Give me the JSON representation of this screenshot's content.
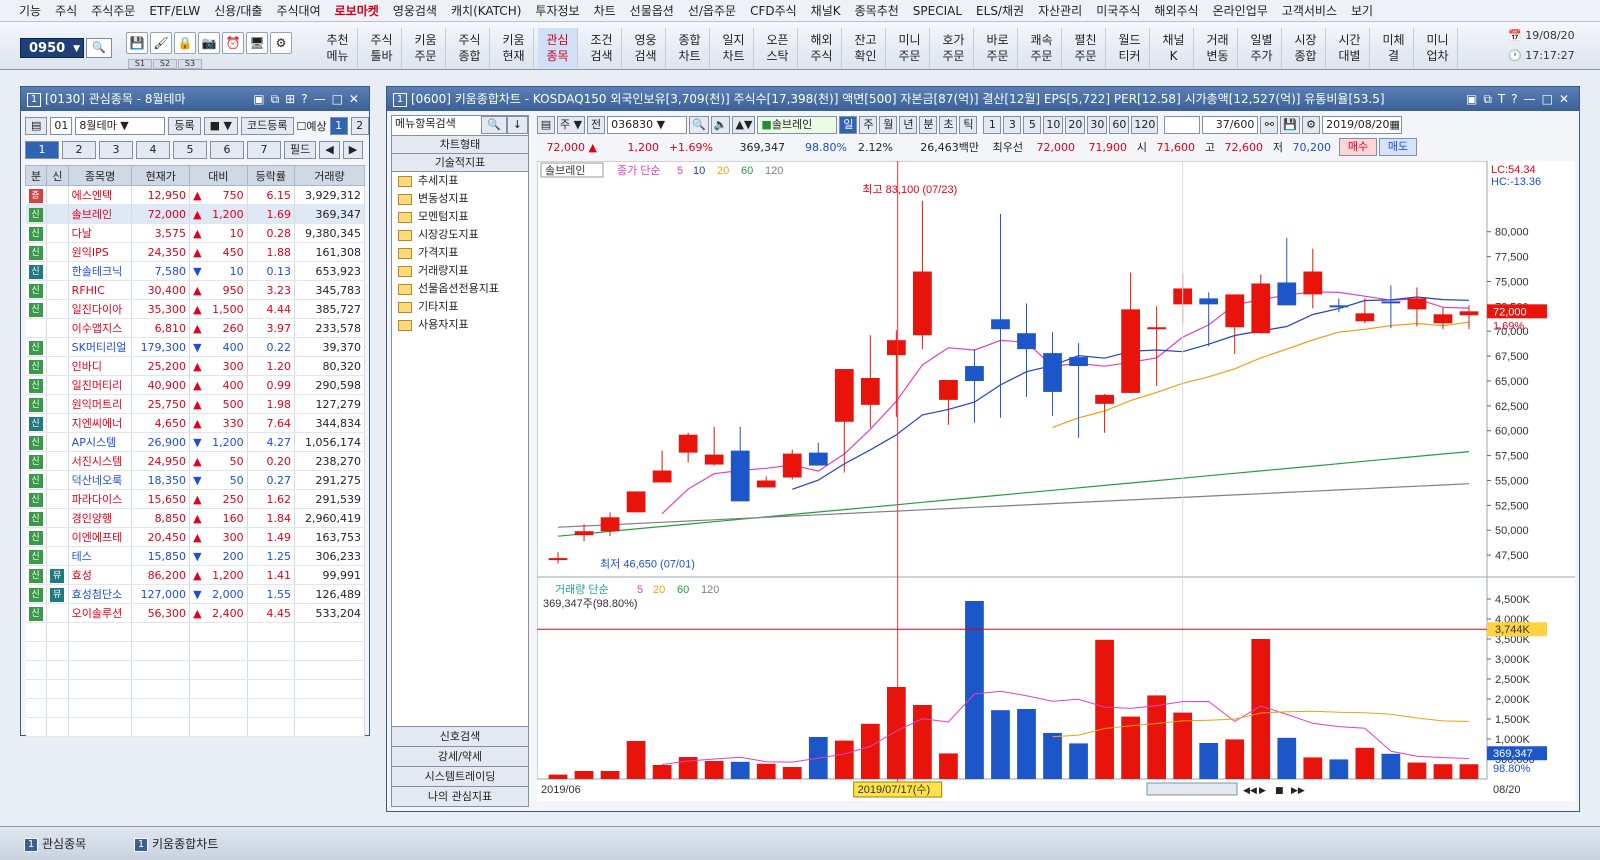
{
  "menu": [
    "기능",
    "주식",
    "주식주문",
    "ETF/ELW",
    "신용/대출",
    "주식대여",
    "로보마켓",
    "영웅검색",
    "캐치(KATCH)",
    "투자정보",
    "차트",
    "선물옵션",
    "선/옵주문",
    "CFD주식",
    "채널K",
    "종목추천",
    "SPECIAL",
    "ELS/채권",
    "자산관리",
    "미국주식",
    "해외주식",
    "온라인업무",
    "고객서비스",
    "보기"
  ],
  "toolbar": {
    "code": "0950",
    "screens": [
      "S1",
      "S2",
      "S3"
    ],
    "buttons": [
      [
        "추천",
        "메뉴"
      ],
      [
        "주식",
        "툴바"
      ],
      [
        "키움",
        "주문"
      ],
      [
        "주식",
        "종합"
      ],
      [
        "키움",
        "현재"
      ],
      [
        "관심",
        "종목"
      ],
      [
        "조건",
        "검색"
      ],
      [
        "영웅",
        "검색"
      ],
      [
        "종합",
        "차트"
      ],
      [
        "일지",
        "차트"
      ],
      [
        "오픈",
        "스탁"
      ],
      [
        "해외",
        "주식"
      ],
      [
        "잔고",
        "확인"
      ],
      [
        "미니",
        "주문"
      ],
      [
        "호가",
        "주문"
      ],
      [
        "바로",
        "주문"
      ],
      [
        "쾌속",
        "주문"
      ],
      [
        "펼친",
        "주문"
      ],
      [
        "월드",
        "티커"
      ],
      [
        "채널",
        "K"
      ],
      [
        "거래",
        "변동"
      ],
      [
        "일별",
        "주가"
      ],
      [
        "시장",
        "종합"
      ],
      [
        "시간",
        "대별"
      ],
      [
        "미체",
        "결"
      ],
      [
        "미니",
        "업차"
      ]
    ],
    "active_button": "관심종목",
    "date": "19/08/20",
    "time": "17:17:27"
  },
  "watch": {
    "title": "[0130] 관심종목 - 8월테마",
    "num": "1",
    "group_no": "01",
    "group_name": "8월테마",
    "reg_btn": "등록",
    "code_reg_btn": "코드등록",
    "predict": "예상",
    "pages": [
      "1",
      "2"
    ],
    "tabs": [
      "1",
      "2",
      "3",
      "4",
      "5",
      "6",
      "7"
    ],
    "field_btn": "필드",
    "headers": [
      "분",
      "신",
      "종목명",
      "현재가",
      "대비",
      "등락률",
      "거래량"
    ],
    "rows": [
      {
        "tag": "증",
        "tagc": "red",
        "name": "에스엔텍",
        "price": "12,950",
        "dir": "▲",
        "chg": "750",
        "rate": "6.15",
        "vol": "3,929,312",
        "up": true
      },
      {
        "tag": "신",
        "tagc": "",
        "name": "솔브레인",
        "price": "72,000",
        "dir": "▲",
        "chg": "1,200",
        "rate": "1.69",
        "vol": "369,347",
        "up": true,
        "sel": true
      },
      {
        "tag": "신",
        "tagc": "",
        "name": "다날",
        "price": "3,575",
        "dir": "▲",
        "chg": "10",
        "rate": "0.28",
        "vol": "9,380,345",
        "up": true
      },
      {
        "tag": "신",
        "tagc": "",
        "name": "원익IPS",
        "price": "24,350",
        "dir": "▲",
        "chg": "450",
        "rate": "1.88",
        "vol": "161,308",
        "up": true
      },
      {
        "tag": "신",
        "tagc": "teal",
        "name": "한솔테크닉",
        "price": "7,580",
        "dir": "▼",
        "chg": "10",
        "rate": "0.13",
        "vol": "653,923",
        "up": false
      },
      {
        "tag": "신",
        "tagc": "",
        "name": "RFHIC",
        "price": "30,400",
        "dir": "▲",
        "chg": "950",
        "rate": "3.23",
        "vol": "345,783",
        "up": true
      },
      {
        "tag": "신",
        "tagc": "",
        "name": "일진다이아",
        "price": "35,300",
        "dir": "▲",
        "chg": "1,500",
        "rate": "4.44",
        "vol": "385,727",
        "up": true
      },
      {
        "tag": "",
        "tagc": "",
        "name": "이수앱지스",
        "price": "6,810",
        "dir": "▲",
        "chg": "260",
        "rate": "3.97",
        "vol": "233,578",
        "up": true
      },
      {
        "tag": "신",
        "tagc": "",
        "name": "SK머티리얼",
        "price": "179,300",
        "dir": "▼",
        "chg": "400",
        "rate": "0.22",
        "vol": "39,370",
        "up": false
      },
      {
        "tag": "신",
        "tagc": "",
        "name": "인바디",
        "price": "25,200",
        "dir": "▲",
        "chg": "300",
        "rate": "1.20",
        "vol": "80,320",
        "up": true
      },
      {
        "tag": "신",
        "tagc": "",
        "name": "일진머티리",
        "price": "40,900",
        "dir": "▲",
        "chg": "400",
        "rate": "0.99",
        "vol": "290,598",
        "up": true
      },
      {
        "tag": "신",
        "tagc": "",
        "name": "원익머트리",
        "price": "25,750",
        "dir": "▲",
        "chg": "500",
        "rate": "1.98",
        "vol": "127,279",
        "up": true
      },
      {
        "tag": "신",
        "tagc": "teal",
        "name": "지엔씨에너",
        "price": "4,650",
        "dir": "▲",
        "chg": "330",
        "rate": "7.64",
        "vol": "344,834",
        "up": true
      },
      {
        "tag": "신",
        "tagc": "",
        "name": "AP시스템",
        "price": "26,900",
        "dir": "▼",
        "chg": "1,200",
        "rate": "4.27",
        "vol": "1,056,174",
        "up": false
      },
      {
        "tag": "신",
        "tagc": "",
        "name": "서진시스템",
        "price": "24,950",
        "dir": "▲",
        "chg": "50",
        "rate": "0.20",
        "vol": "238,270",
        "up": true
      },
      {
        "tag": "신",
        "tagc": "",
        "name": "덕산네오룩",
        "price": "18,350",
        "dir": "▼",
        "chg": "50",
        "rate": "0.27",
        "vol": "291,275",
        "up": false
      },
      {
        "tag": "신",
        "tagc": "",
        "name": "파라다이스",
        "price": "15,650",
        "dir": "▲",
        "chg": "250",
        "rate": "1.62",
        "vol": "291,539",
        "up": true
      },
      {
        "tag": "신",
        "tagc": "",
        "name": "경인양행",
        "price": "8,850",
        "dir": "▲",
        "chg": "160",
        "rate": "1.84",
        "vol": "2,960,419",
        "up": true
      },
      {
        "tag": "신",
        "tagc": "",
        "name": "이엔에프테",
        "price": "20,450",
        "dir": "▲",
        "chg": "300",
        "rate": "1.49",
        "vol": "163,753",
        "up": true
      },
      {
        "tag": "신",
        "tagc": "",
        "name": "테스",
        "price": "15,850",
        "dir": "▼",
        "chg": "200",
        "rate": "1.25",
        "vol": "306,233",
        "up": false
      },
      {
        "tag": "신",
        "tagc": "",
        "tag2": "뮤",
        "name": "효성",
        "price": "86,200",
        "dir": "▲",
        "chg": "1,200",
        "rate": "1.41",
        "vol": "99,991",
        "up": true
      },
      {
        "tag": "신",
        "tagc": "",
        "tag2": "뮤",
        "name": "효성첨단소",
        "price": "127,000",
        "dir": "▼",
        "chg": "2,000",
        "rate": "1.55",
        "vol": "126,489",
        "up": false
      },
      {
        "tag": "신",
        "tagc": "",
        "name": "오이솔루션",
        "price": "56,300",
        "dir": "▲",
        "chg": "2,400",
        "rate": "4.45",
        "vol": "533,204",
        "up": true
      }
    ]
  },
  "chartwin": {
    "title": "[0600] 키움종합차트 - KOSDAQ150 외국인보유[3,709(천)] 주식수[17,398(천)] 액면[500] 자본금[87(억)] 결산[12월] EPS[5,722] PER[12.58] 시가총액[12,527(억)] 유통비율[53.5]",
    "num": "1",
    "menu_search": "메뉴항목검색",
    "chart_form": "차트형태",
    "tech_ind": "기술적지표",
    "folders": [
      "추세지표",
      "변동성지표",
      "모멘텀지표",
      "시장강도지표",
      "가격지표",
      "거래량지표",
      "선물옵션전용지표",
      "기타지표",
      "사용자지표"
    ],
    "bottom_btns": [
      "신호검색",
      "강세/약세",
      "시스템트레이딩",
      "나의 관심지표"
    ],
    "code": "036830",
    "name": "솔브레인",
    "periods": [
      "일",
      "주",
      "월",
      "년",
      "분",
      "초",
      "틱"
    ],
    "minutes": [
      "1",
      "3",
      "5",
      "10",
      "20",
      "30",
      "60",
      "120"
    ],
    "count": "37/600",
    "date": "2019/08/20",
    "quote": {
      "price": "72,000 ▲",
      "chg": "1,200",
      "rate": "+1.69%",
      "vol": "369,347",
      "vrate": "98.80%",
      "turn": "2.12%",
      "amount": "26,463백만",
      "pref": "최우선",
      "ask": "72,000",
      "bid": "71,900",
      "open_l": "시",
      "open": "71,600",
      "high_l": "고",
      "high": "72,600",
      "low_l": "저",
      "low": "70,200",
      "buy": "매수",
      "sell": "매도"
    },
    "legend_name": "솔브레인",
    "legend_ma": "종가 단순",
    "vol_legend": "거래량 단순",
    "vol_sub": "369,347주(98.80%)",
    "maxlabel": "최고 83,100 (07/23)",
    "minlabel": "최저 46,650 (07/01)",
    "lc": "LC:54.34",
    "hc": "HC:-13.36",
    "pricetag": "72,000",
    "pcttag": "1.69%",
    "voltag": "3,744K",
    "vollast": "369,347",
    "volpct": "98.80%",
    "xl_left": "2019/06",
    "xl_mid": "08",
    "xl_right": "08/20",
    "cursor_date": "2019/07/17(수)"
  },
  "chart_data": {
    "type": "candlestick",
    "ylim": [
      45500,
      85500
    ],
    "yticks": [
      47500,
      50000,
      52500,
      55000,
      57500,
      60000,
      62500,
      65000,
      67500,
      70000,
      72500,
      75000,
      77500,
      80000
    ],
    "vticks": [
      "500,000",
      "1,000K",
      "1,500K",
      "2,000K",
      "2,500K",
      "3,000K",
      "3,500K",
      "4,000K",
      "4,500K"
    ],
    "vmax": 4700,
    "ohlc": [
      [
        47100,
        47800,
        46650,
        47200
      ],
      [
        49500,
        50600,
        48900,
        49900
      ],
      [
        49900,
        51800,
        49400,
        51300
      ],
      [
        51800,
        53900,
        51800,
        53900
      ],
      [
        54800,
        58000,
        54800,
        56000
      ],
      [
        57800,
        59800,
        56800,
        59600
      ],
      [
        56600,
        60400,
        56500,
        57600
      ],
      [
        58000,
        60400,
        52900,
        52900
      ],
      [
        54300,
        55400,
        54300,
        55000
      ],
      [
        55300,
        58100,
        55100,
        57700
      ],
      [
        57800,
        58800,
        57200,
        56500
      ],
      [
        60900,
        66000,
        55800,
        66200
      ],
      [
        62600,
        69600,
        60300,
        65300
      ],
      [
        67600,
        70100,
        61400,
        69100
      ],
      [
        69600,
        83100,
        68200,
        76000
      ],
      [
        63100,
        65000,
        60600,
        65100
      ],
      [
        66500,
        68200,
        60800,
        65000
      ],
      [
        71200,
        81800,
        61300,
        70200
      ],
      [
        69800,
        72800,
        63400,
        68200
      ],
      [
        67800,
        69900,
        61500,
        63900
      ],
      [
        67400,
        68800,
        59300,
        66500
      ],
      [
        62700,
        63700,
        59800,
        63600
      ],
      [
        63800,
        75900,
        63800,
        72200
      ],
      [
        70400,
        72500,
        64500,
        70400
      ],
      [
        72700,
        75800,
        70800,
        74300
      ],
      [
        73300,
        73900,
        68500,
        72700
      ],
      [
        70400,
        73300,
        67700,
        73700
      ],
      [
        69800,
        75700,
        69800,
        74800
      ],
      [
        74900,
        79400,
        72800,
        72600
      ],
      [
        73700,
        78300,
        72300,
        76000
      ],
      [
        72600,
        73300,
        71900,
        72400
      ],
      [
        71000,
        73300,
        70800,
        71800
      ],
      [
        73000,
        74600,
        70300,
        72800
      ],
      [
        72200,
        74400,
        70500,
        73300
      ],
      [
        70800,
        72400,
        70200,
        71700
      ],
      [
        71600,
        72600,
        70200,
        72000
      ]
    ],
    "volume": [
      110,
      200,
      200,
      950,
      350,
      550,
      450,
      430,
      380,
      300,
      1050,
      960,
      1380,
      2300,
      1850,
      640,
      4450,
      1720,
      1750,
      1150,
      890,
      3480,
      1560,
      2090,
      1660,
      900,
      990,
      3500,
      1030,
      540,
      490,
      780,
      630,
      410,
      370,
      369
    ]
  }
}
